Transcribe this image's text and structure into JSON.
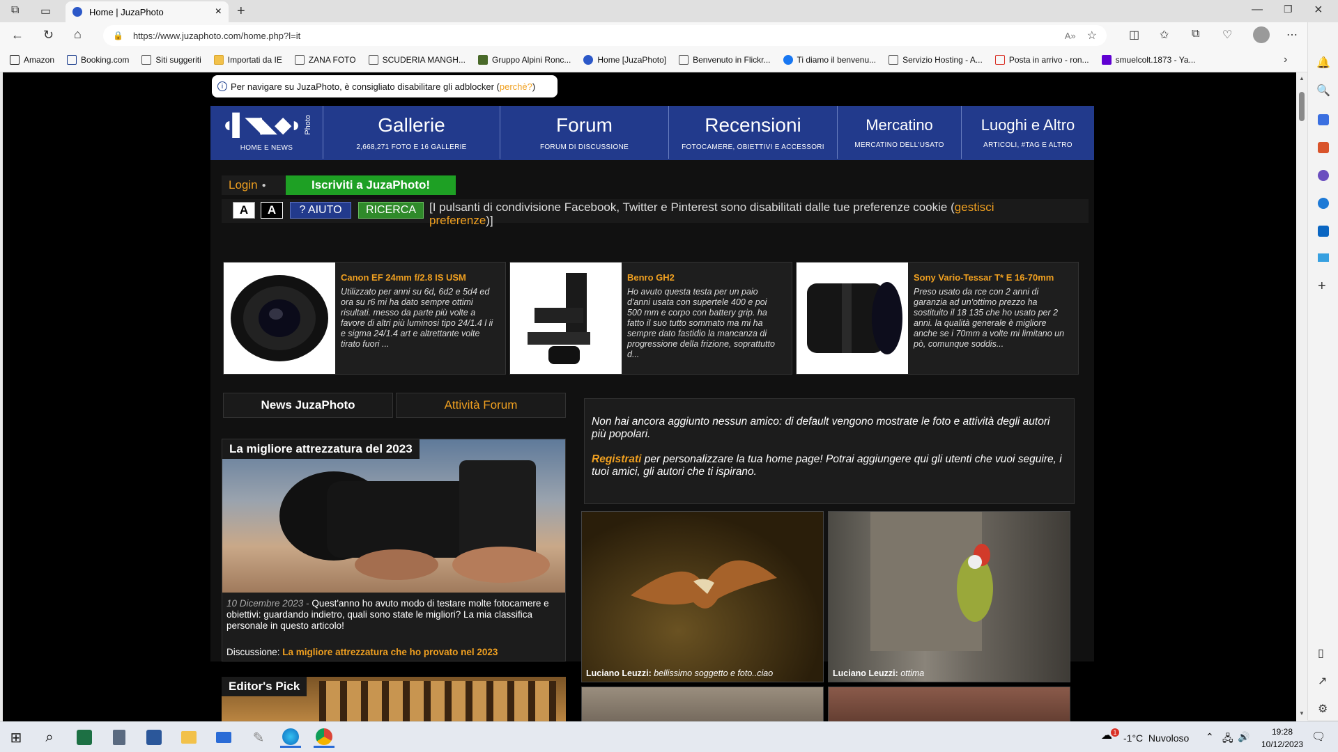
{
  "browser": {
    "tab_title": "Home | JuzaPhoto",
    "url": "https://www.juzaphoto.com/home.php?l=it",
    "bookmarks": [
      "Amazon",
      "Booking.com",
      "Siti suggeriti",
      "Importati da IE",
      "ZANA FOTO",
      "SCUDERIA MANGH...",
      "Gruppo Alpini Ronc...",
      "Home [JuzaPhoto]",
      "Benvenuto in Flickr...",
      "Ti diamo il benvenu...",
      "Servizio Hosting - A...",
      "Posta in arrivo - ron...",
      "smuelcolt.1873 - Ya..."
    ]
  },
  "site": {
    "adblock_notice": "Per navigare su JuzaPhoto, è consigliato disabilitare gli adblocker (",
    "adblock_link": "perchè?",
    "adblock_close": ")",
    "logo_side": "Photo",
    "home_label": "HOME E NEWS",
    "nav": [
      {
        "title": "Gallerie",
        "sub": "2,668,271 FOTO E 16 GALLERIE"
      },
      {
        "title": "Forum",
        "sub": "FORUM DI DISCUSSIONE"
      },
      {
        "title": "Recensioni",
        "sub": "FOTOCAMERE, OBIETTIVI E ACCESSORI"
      },
      {
        "title": "Mercatino",
        "sub": "MERCATINO DELL'USATO"
      },
      {
        "title": "Luoghi e Altro",
        "sub": "ARTICOLI, #TAG E ALTRO"
      }
    ],
    "login": "Login",
    "signup": "Iscriviti a JuzaPhoto!",
    "font_a1": "A",
    "font_a2": "A",
    "help": "? AIUTO",
    "search": "RICERCA",
    "cookie_text": "[I pulsanti di condivisione Facebook, Twitter e Pinterest sono disabilitati dalle tue preferenze cookie (",
    "cookie_link1": "gestisci",
    "cookie_link2": "preferenze",
    "cookie_end": ")]",
    "cards": [
      {
        "title": "Canon EF 24mm f/2.8 IS USM",
        "desc": "Utilizzato per anni su 6d, 6d2 e 5d4 ed ora su r6 mi ha dato sempre ottimi risultati. messo da parte più volte a favore di altri più luminosi tipo 24/1.4 l ii e sigma 24/1.4 art e altrettante volte tirato fuori ..."
      },
      {
        "title": "Benro GH2",
        "desc": "Ho avuto questa testa per un paio d'anni usata con supertele 400 e poi 500 mm e corpo con battery grip. ha fatto il suo tutto sommato ma mi ha sempre dato fastidio la mancanza di progressione della frizione, soprattutto d..."
      },
      {
        "title": "Sony Vario-Tessar T* E 16-70mm",
        "desc": "Preso usato da rce con 2 anni di garanzia ad un'ottimo prezzo ha sostituito il 18 135 che ho usato per 2 anni. la qualità generale è migliore anche se i 70mm a volte mi limitano un pò, comunque soddis..."
      }
    ],
    "tab_news": "News JuzaPhoto",
    "tab_forum": "Attività Forum",
    "news_title": "La migliore attrezzatura del 2023",
    "news_date": "10 Dicembre 2023",
    "news_sep": " - ",
    "news_body": "Quest'anno ho avuto modo di testare molte fotocamere e obiettivi: guardando indietro, quali sono state le migliori? La mia classifica personale in questo articolo!",
    "news_disc_label": "Discussione: ",
    "news_disc_link": "La migliore attrezzatura che ho provato nel 2023",
    "editors_pick": "Editor's Pick",
    "friends_text": "Non hai ancora aggiunto nessun amico: di default vengono mostrate le foto e attività degli autori più popolari.",
    "register_link": "Registrati",
    "register_text": " per personalizzare la tua home page! Potrai aggiungere qui gli utenti che vuoi seguire, i tuoi amici, gli autori che ti ispirano.",
    "photos": [
      {
        "author": "Luciano Leuzzi:",
        "comment": " bellissimo soggetto e foto..ciao"
      },
      {
        "author": "Luciano Leuzzi:",
        "comment": " ottima"
      }
    ]
  },
  "taskbar": {
    "weather": "-1°C  Nuvoloso",
    "time": "19:28",
    "date": "10/12/2023",
    "badge": "1"
  }
}
